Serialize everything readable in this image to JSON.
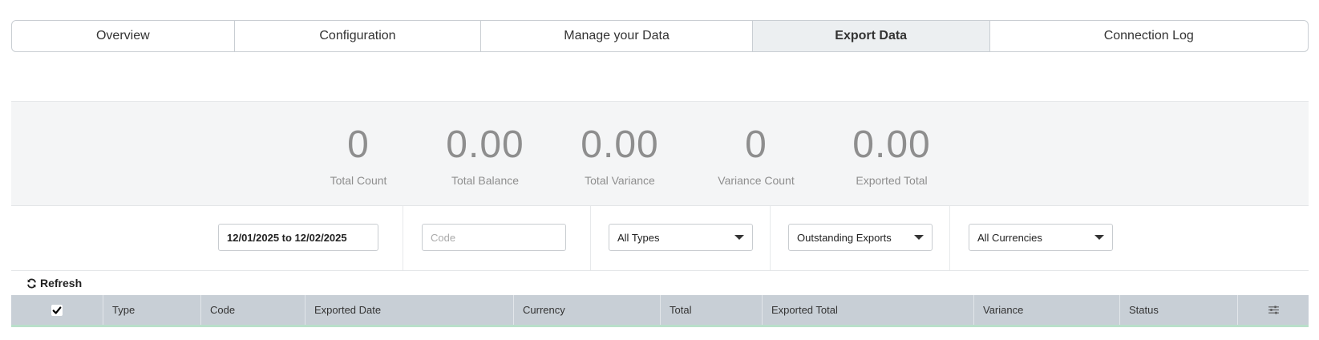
{
  "tabs": [
    {
      "label": "Overview",
      "active": false
    },
    {
      "label": "Configuration",
      "active": false
    },
    {
      "label": "Manage your Data",
      "active": false
    },
    {
      "label": "Export Data",
      "active": true
    },
    {
      "label": "Connection Log",
      "active": false
    }
  ],
  "stats": [
    {
      "value": "0",
      "label": "Total Count"
    },
    {
      "value": "0.00",
      "label": "Total Balance"
    },
    {
      "value": "0.00",
      "label": "Total Variance"
    },
    {
      "value": "0",
      "label": "Variance Count"
    },
    {
      "value": "0.00",
      "label": "Exported Total"
    }
  ],
  "filters": {
    "date_range": "12/01/2025 to 12/02/2025",
    "code_placeholder": "Code",
    "type_select": "All Types",
    "export_select": "Outstanding Exports",
    "currency_select": "All Currencies"
  },
  "toolbar": {
    "refresh_label": "Refresh",
    "refresh_icon": "refresh-icon"
  },
  "table": {
    "select_all_checked": true,
    "columns": [
      "Type",
      "Code",
      "Exported Date",
      "Currency",
      "Total",
      "Exported Total",
      "Variance",
      "Status"
    ],
    "settings_icon": "sliders-icon"
  },
  "colors": {
    "active_tab_bg": "#eceff1",
    "stats_bg": "#f4f5f6",
    "header_bg": "#c8cfd6",
    "header_accent": "#b9dfca",
    "stat_text": "#8e8e8e"
  }
}
